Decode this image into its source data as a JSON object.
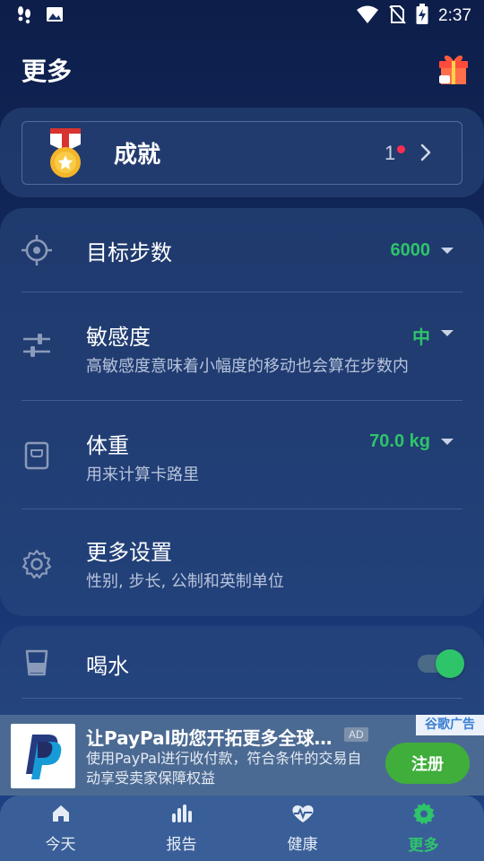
{
  "status_bar": {
    "time": "2:37"
  },
  "header": {
    "title": "更多"
  },
  "achievement": {
    "label": "成就",
    "count": "1"
  },
  "settings": [
    {
      "title": "目标步数",
      "value": "6000",
      "subtitle": ""
    },
    {
      "title": "敏感度",
      "value": "中",
      "subtitle": "高敏感度意味着小幅度的移动也会算在步数内"
    },
    {
      "title": "体重",
      "value": "70.0 kg",
      "subtitle": "用来计算卡路里"
    },
    {
      "title": "更多设置",
      "value": "",
      "subtitle": "性别, 步长, 公制和英制单位"
    }
  ],
  "water": {
    "title": "喝水",
    "enabled": true
  },
  "ad": {
    "title": "让PayPal助您开拓更多全球…",
    "tag": "AD",
    "description": "使用PayPal进行收付款，符合条件的交易自动享受卖家保障权益",
    "source": "谷歌广告",
    "cta": "注册"
  },
  "nav": [
    {
      "label": "今天",
      "icon": "home-icon",
      "active": false
    },
    {
      "label": "报告",
      "icon": "bar-chart-icon",
      "active": false
    },
    {
      "label": "健康",
      "icon": "heart-pulse-icon",
      "active": false
    },
    {
      "label": "更多",
      "icon": "gear-icon",
      "active": true
    }
  ],
  "colors": {
    "accent": "#2ec46a",
    "background_top": "#0d1e4a",
    "background_bottom": "#1e4387",
    "badge": "#ff2d4f"
  }
}
